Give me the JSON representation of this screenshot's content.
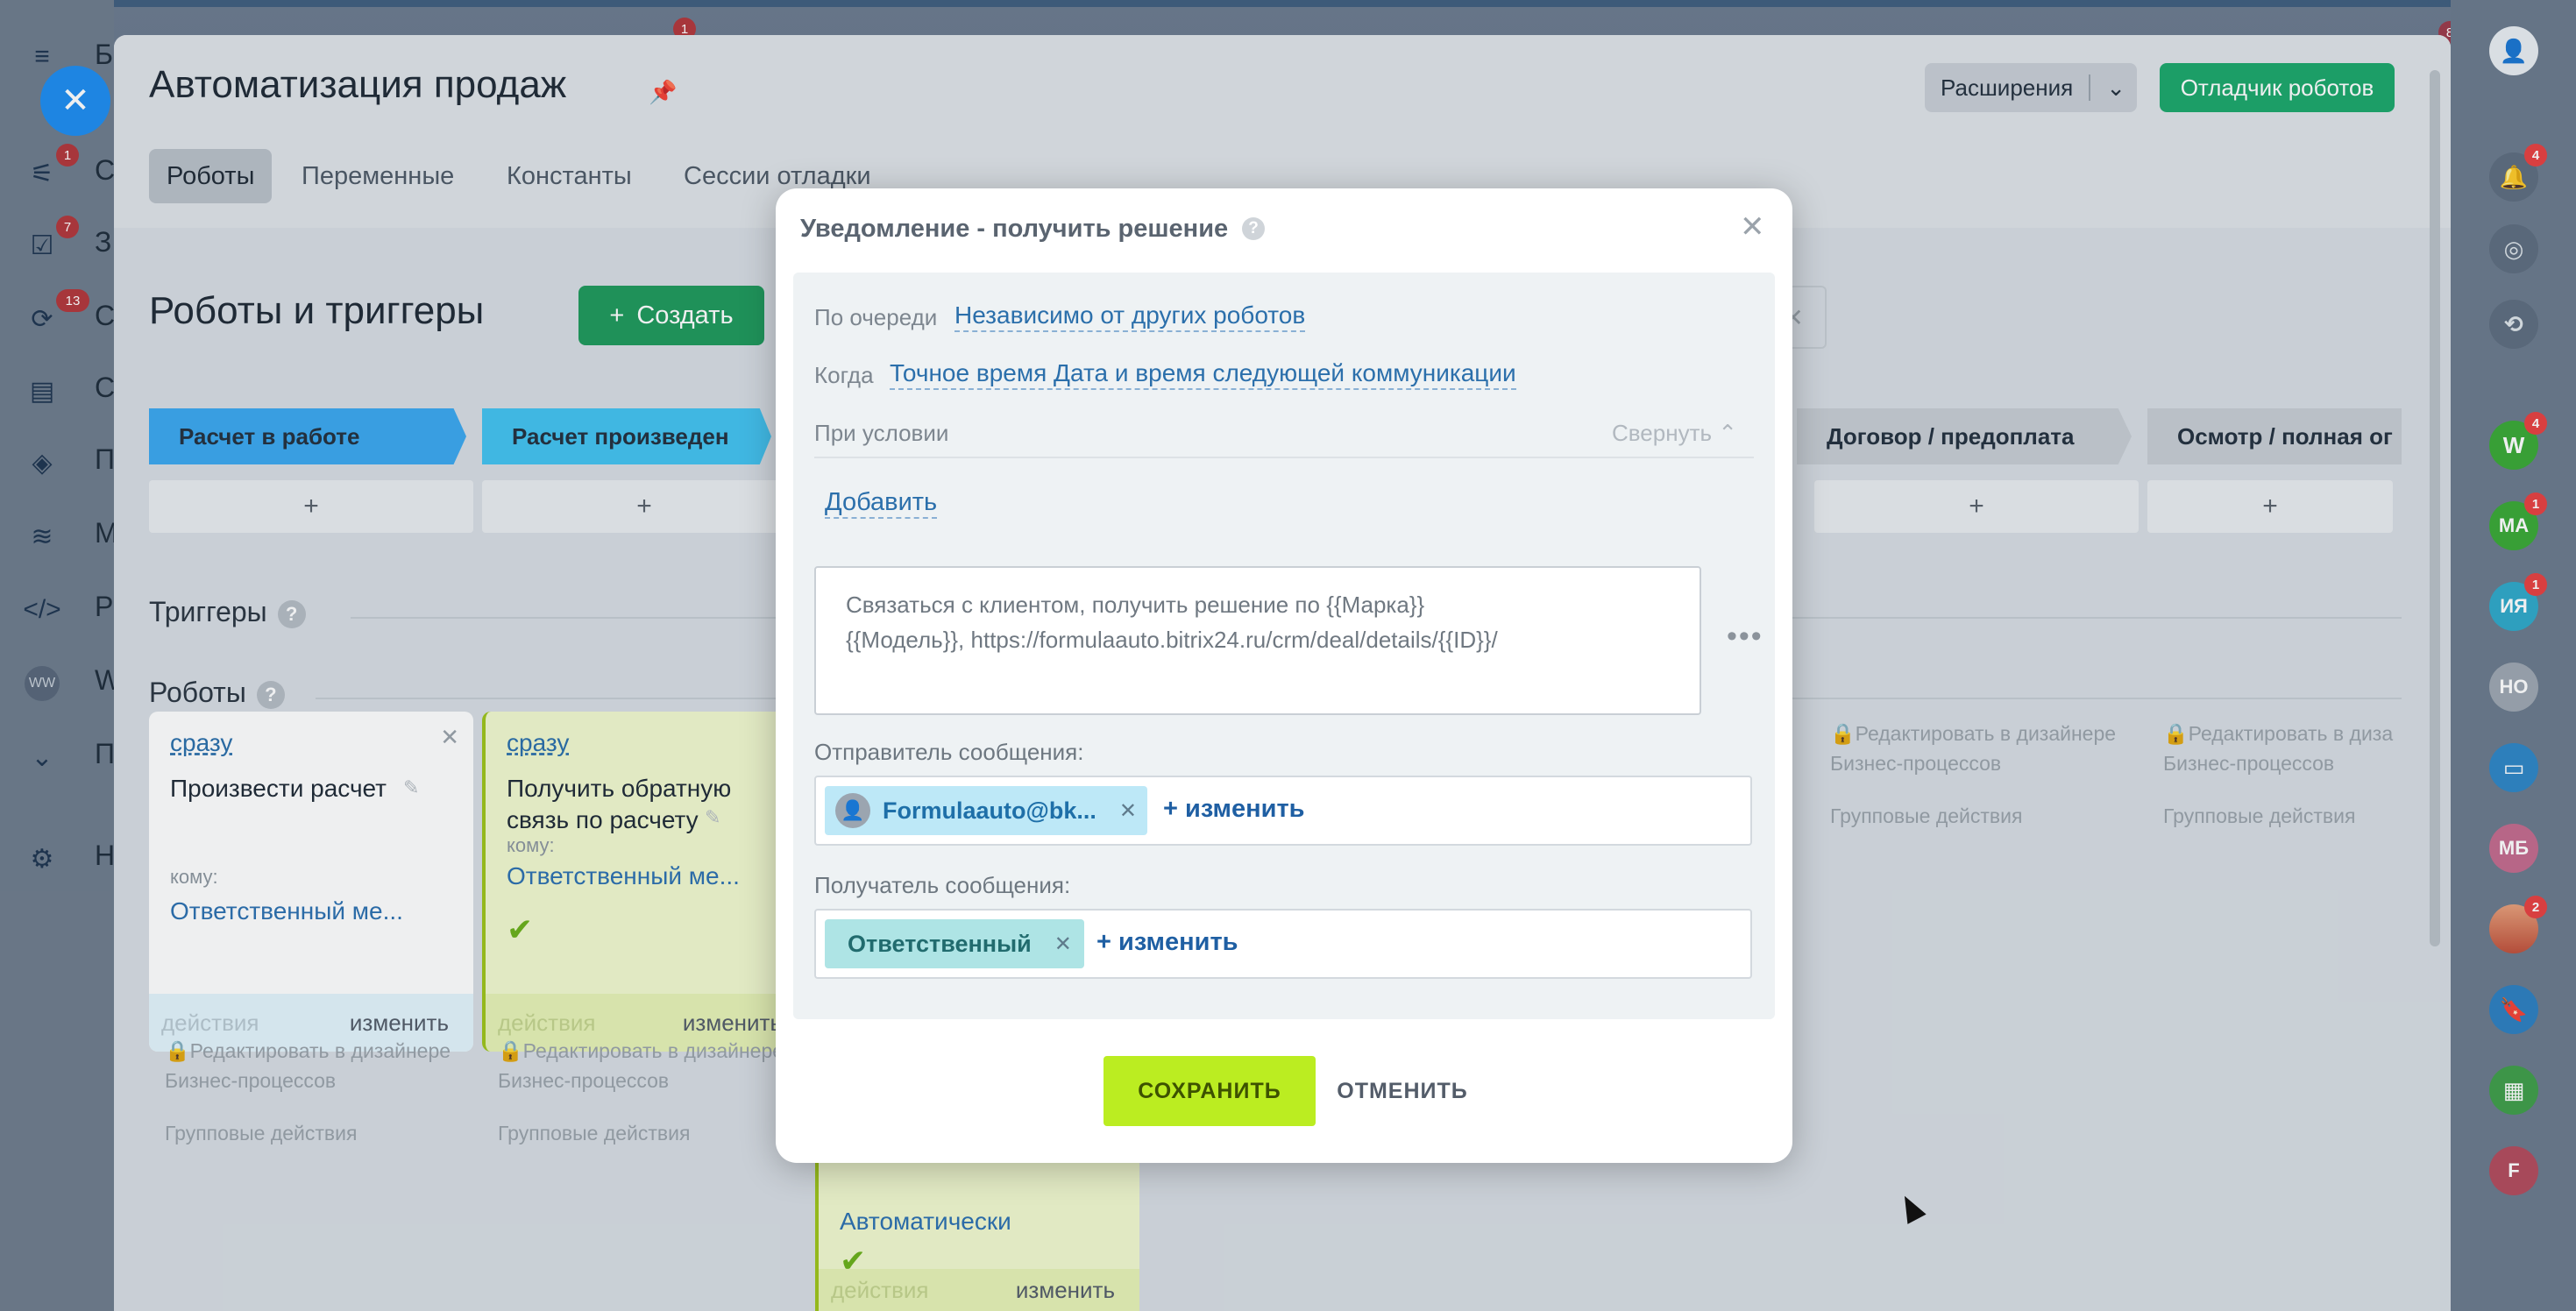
{
  "app": {
    "title": "Автоматизация продаж",
    "left_menu": [
      {
        "icon": "menu-icon",
        "label": "Б"
      },
      {
        "icon": "funnel-icon",
        "label": "С",
        "badge": "1"
      },
      {
        "icon": "tasks-icon",
        "label": "З",
        "badge": "7"
      },
      {
        "icon": "chat-icon",
        "label": "С",
        "badge": "13"
      },
      {
        "icon": "card-icon",
        "label": "С"
      },
      {
        "icon": "box-icon",
        "label": "П"
      },
      {
        "icon": "marketing-icon",
        "label": "М"
      },
      {
        "icon": "code-icon",
        "label": "Р"
      },
      {
        "icon": "ww-icon",
        "label": "W",
        "avatar": "WW"
      },
      {
        "icon": "chevron-down-icon",
        "label": "П"
      },
      {
        "icon": "gear-icon",
        "label": "Н"
      }
    ],
    "top_badge": "1",
    "top_right_badge": "8"
  },
  "header": {
    "extensions_label": "Расширения",
    "debugger_label": "Отладчик роботов",
    "tabs": [
      {
        "label": "Роботы",
        "active": true
      },
      {
        "label": "Переменные",
        "active": false
      },
      {
        "label": "Константы",
        "active": false
      },
      {
        "label": "Сессии отладки",
        "active": false
      }
    ]
  },
  "main": {
    "section_title": "Роботы и триггеры",
    "create_label": "Создать",
    "stages": [
      {
        "label": "Расчет в работе",
        "color": "#3ba8ef"
      },
      {
        "label": "Расчет произведен",
        "color": "#43c3f0"
      },
      {
        "label": "Договор / предоплата",
        "color": "#c7cdd3"
      },
      {
        "label": "Осмотр / полная ог",
        "color": "#c7cdd3"
      }
    ],
    "plus": "+",
    "triggers_label": "Триггеры",
    "robots_label": "Роботы",
    "cards": [
      {
        "when": "сразу",
        "name": "Произвести расчет",
        "to_label": "кому:",
        "who": "Ответственный ме...",
        "actions": "действия",
        "change": "изменить"
      },
      {
        "when": "сразу",
        "name_line1": "Получить обратную",
        "name_line2": "связь по расчету",
        "to_label": "кому:",
        "who": "Ответственный ме...",
        "actions": "действия",
        "change": "изменить"
      },
      {
        "who": "Автоматически",
        "actions": "действия",
        "change": "изменить"
      }
    ],
    "lock_note_line1": "Редактировать в дизайнере",
    "lock_note_line1_short": "Редактировать в диза",
    "lock_note_line2": "Бизнес-процессов",
    "group_actions": "Групповые действия"
  },
  "right_rail": [
    {
      "icon": "profile-icon"
    },
    {
      "icon": "bell-icon",
      "badge": "4"
    },
    {
      "icon": "target-icon"
    },
    {
      "icon": "refresh-icon"
    },
    {
      "initials": "W",
      "color": "#3aa936",
      "badge": "4"
    },
    {
      "initials": "МА",
      "color": "#3aa936",
      "badge": "1"
    },
    {
      "initials": "ИЯ",
      "color": "#2fa9c9",
      "badge": "1"
    },
    {
      "initials": "НО",
      "color": "#9ea7b1"
    },
    {
      "icon": "chat-bubble-icon",
      "color": "#2e86c6"
    },
    {
      "initials": "МБ",
      "color": "#c46b8e"
    },
    {
      "icon": "user-photo-icon",
      "badge": "2"
    },
    {
      "icon": "bookmark-icon",
      "color": "#2d7fc0"
    },
    {
      "icon": "document-icon",
      "color": "#3f9e49"
    },
    {
      "initials": "F",
      "color": "#b24b5d"
    }
  ],
  "modal": {
    "title": "Уведомление - получить решение",
    "order_label": "По очереди",
    "order_value": "Независимо от других роботов",
    "when_label": "Когда",
    "when_value": "Точное время Дата и время следующей коммуникации",
    "condition_label": "При условии",
    "collapse_label": "Свернуть",
    "add_label": "Добавить",
    "message_line1": "Связаться с клиентом, получить решение по {{Марка}}",
    "message_line2": "{{Модель}}, https://formulaauto.bitrix24.ru/crm/deal/details/{{ID}}/",
    "sender_label": "Отправитель сообщения:",
    "sender_chip": "Formulaauto@bk...",
    "recipient_label": "Получатель сообщения:",
    "recipient_chip": "Ответственный",
    "change_label": "+ изменить",
    "save_label": "СОХРАНИТЬ",
    "cancel_label": "ОТМЕНИТЬ"
  }
}
